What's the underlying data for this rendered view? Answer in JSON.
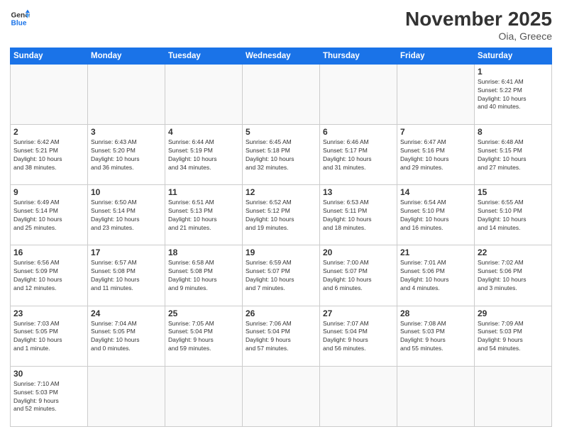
{
  "header": {
    "logo_general": "General",
    "logo_blue": "Blue",
    "title": "November 2025",
    "subtitle": "Oia, Greece"
  },
  "weekdays": [
    "Sunday",
    "Monday",
    "Tuesday",
    "Wednesday",
    "Thursday",
    "Friday",
    "Saturday"
  ],
  "weeks": [
    [
      {
        "day": null,
        "info": null
      },
      {
        "day": null,
        "info": null
      },
      {
        "day": null,
        "info": null
      },
      {
        "day": null,
        "info": null
      },
      {
        "day": null,
        "info": null
      },
      {
        "day": null,
        "info": null
      },
      {
        "day": "1",
        "info": "Sunrise: 6:41 AM\nSunset: 5:22 PM\nDaylight: 10 hours\nand 40 minutes."
      }
    ],
    [
      {
        "day": "2",
        "info": "Sunrise: 6:42 AM\nSunset: 5:21 PM\nDaylight: 10 hours\nand 38 minutes."
      },
      {
        "day": "3",
        "info": "Sunrise: 6:43 AM\nSunset: 5:20 PM\nDaylight: 10 hours\nand 36 minutes."
      },
      {
        "day": "4",
        "info": "Sunrise: 6:44 AM\nSunset: 5:19 PM\nDaylight: 10 hours\nand 34 minutes."
      },
      {
        "day": "5",
        "info": "Sunrise: 6:45 AM\nSunset: 5:18 PM\nDaylight: 10 hours\nand 32 minutes."
      },
      {
        "day": "6",
        "info": "Sunrise: 6:46 AM\nSunset: 5:17 PM\nDaylight: 10 hours\nand 31 minutes."
      },
      {
        "day": "7",
        "info": "Sunrise: 6:47 AM\nSunset: 5:16 PM\nDaylight: 10 hours\nand 29 minutes."
      },
      {
        "day": "8",
        "info": "Sunrise: 6:48 AM\nSunset: 5:15 PM\nDaylight: 10 hours\nand 27 minutes."
      }
    ],
    [
      {
        "day": "9",
        "info": "Sunrise: 6:49 AM\nSunset: 5:14 PM\nDaylight: 10 hours\nand 25 minutes."
      },
      {
        "day": "10",
        "info": "Sunrise: 6:50 AM\nSunset: 5:14 PM\nDaylight: 10 hours\nand 23 minutes."
      },
      {
        "day": "11",
        "info": "Sunrise: 6:51 AM\nSunset: 5:13 PM\nDaylight: 10 hours\nand 21 minutes."
      },
      {
        "day": "12",
        "info": "Sunrise: 6:52 AM\nSunset: 5:12 PM\nDaylight: 10 hours\nand 19 minutes."
      },
      {
        "day": "13",
        "info": "Sunrise: 6:53 AM\nSunset: 5:11 PM\nDaylight: 10 hours\nand 18 minutes."
      },
      {
        "day": "14",
        "info": "Sunrise: 6:54 AM\nSunset: 5:10 PM\nDaylight: 10 hours\nand 16 minutes."
      },
      {
        "day": "15",
        "info": "Sunrise: 6:55 AM\nSunset: 5:10 PM\nDaylight: 10 hours\nand 14 minutes."
      }
    ],
    [
      {
        "day": "16",
        "info": "Sunrise: 6:56 AM\nSunset: 5:09 PM\nDaylight: 10 hours\nand 12 minutes."
      },
      {
        "day": "17",
        "info": "Sunrise: 6:57 AM\nSunset: 5:08 PM\nDaylight: 10 hours\nand 11 minutes."
      },
      {
        "day": "18",
        "info": "Sunrise: 6:58 AM\nSunset: 5:08 PM\nDaylight: 10 hours\nand 9 minutes."
      },
      {
        "day": "19",
        "info": "Sunrise: 6:59 AM\nSunset: 5:07 PM\nDaylight: 10 hours\nand 7 minutes."
      },
      {
        "day": "20",
        "info": "Sunrise: 7:00 AM\nSunset: 5:07 PM\nDaylight: 10 hours\nand 6 minutes."
      },
      {
        "day": "21",
        "info": "Sunrise: 7:01 AM\nSunset: 5:06 PM\nDaylight: 10 hours\nand 4 minutes."
      },
      {
        "day": "22",
        "info": "Sunrise: 7:02 AM\nSunset: 5:06 PM\nDaylight: 10 hours\nand 3 minutes."
      }
    ],
    [
      {
        "day": "23",
        "info": "Sunrise: 7:03 AM\nSunset: 5:05 PM\nDaylight: 10 hours\nand 1 minute."
      },
      {
        "day": "24",
        "info": "Sunrise: 7:04 AM\nSunset: 5:05 PM\nDaylight: 10 hours\nand 0 minutes."
      },
      {
        "day": "25",
        "info": "Sunrise: 7:05 AM\nSunset: 5:04 PM\nDaylight: 9 hours\nand 59 minutes."
      },
      {
        "day": "26",
        "info": "Sunrise: 7:06 AM\nSunset: 5:04 PM\nDaylight: 9 hours\nand 57 minutes."
      },
      {
        "day": "27",
        "info": "Sunrise: 7:07 AM\nSunset: 5:04 PM\nDaylight: 9 hours\nand 56 minutes."
      },
      {
        "day": "28",
        "info": "Sunrise: 7:08 AM\nSunset: 5:03 PM\nDaylight: 9 hours\nand 55 minutes."
      },
      {
        "day": "29",
        "info": "Sunrise: 7:09 AM\nSunset: 5:03 PM\nDaylight: 9 hours\nand 54 minutes."
      }
    ],
    [
      {
        "day": "30",
        "info": "Sunrise: 7:10 AM\nSunset: 5:03 PM\nDaylight: 9 hours\nand 52 minutes."
      },
      {
        "day": null,
        "info": null
      },
      {
        "day": null,
        "info": null
      },
      {
        "day": null,
        "info": null
      },
      {
        "day": null,
        "info": null
      },
      {
        "day": null,
        "info": null
      },
      {
        "day": null,
        "info": null
      }
    ]
  ]
}
